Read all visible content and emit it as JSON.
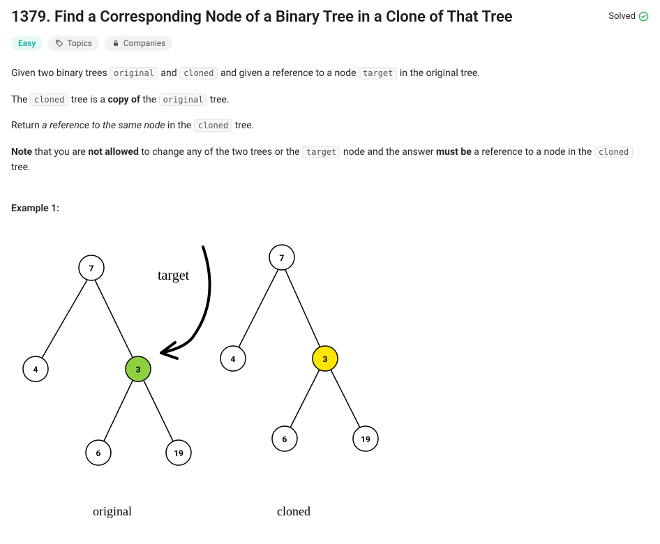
{
  "header": {
    "title": "1379. Find a Corresponding Node of a Binary Tree in a Clone of That Tree",
    "status": "Solved"
  },
  "badges": {
    "difficulty": "Easy",
    "topics": "Topics",
    "companies": "Companies"
  },
  "paragraphs": {
    "p1_a": "Given two binary trees ",
    "p1_c_original": "original",
    "p1_b": " and ",
    "p1_c_cloned": "cloned",
    "p1_c": " and given a reference to a node ",
    "p1_c_target": "target",
    "p1_d": " in the original tree.",
    "p2_a": "The ",
    "p2_code": "cloned",
    "p2_b": " tree is a ",
    "p2_bold": "copy of",
    "p2_c": " the ",
    "p2_code2": "original",
    "p2_d": " tree.",
    "p3_a": "Return ",
    "p3_em": "a reference to the same node",
    "p3_b": " in the ",
    "p3_code": "cloned",
    "p3_c": " tree.",
    "p4_a": "Note",
    "p4_b": " that you are ",
    "p4_c": "not allowed",
    "p4_d": " to change any of the two trees or the ",
    "p4_code": "target",
    "p4_e": " node and the answer ",
    "p4_f": "must be",
    "p4_g": " a reference to a node in the ",
    "p4_code2": "cloned",
    "p4_h": " tree."
  },
  "example": {
    "label": "Example 1:",
    "target_label": "target",
    "caption_original": "original",
    "caption_cloned": "cloned",
    "nodes": {
      "n7": "7",
      "n4": "4",
      "n3": "3",
      "n6": "6",
      "n19": "19"
    }
  }
}
